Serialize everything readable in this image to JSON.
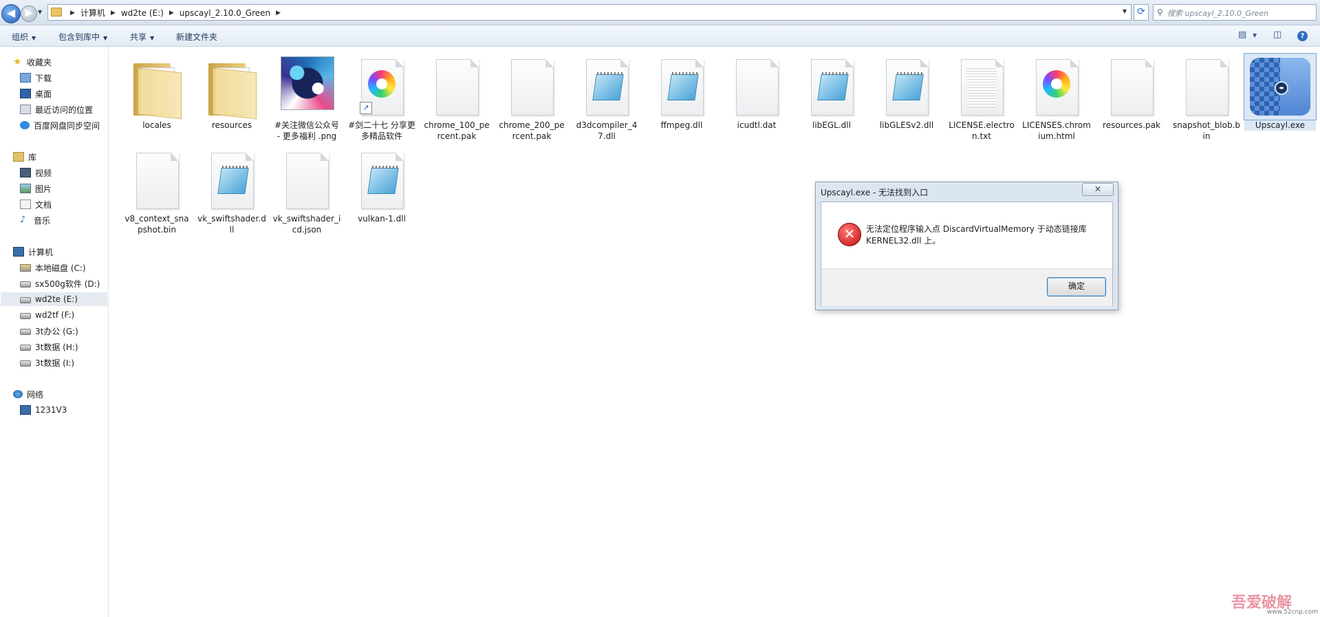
{
  "address": {
    "crumbs": [
      "计算机",
      "wd2te (E:)",
      "upscayl_2.10.0_Green"
    ],
    "search_placeholder": "搜索 upscayl_2.10.0_Green"
  },
  "toolbar": {
    "organize": "组织",
    "include_in_library": "包含到库中",
    "share": "共享",
    "new_folder": "新建文件夹"
  },
  "sidebar": {
    "favorites": {
      "label": "收藏夹",
      "items": [
        "下载",
        "桌面",
        "最近访问的位置",
        "百度网盘同步空间"
      ]
    },
    "libraries": {
      "label": "库",
      "items": [
        "视频",
        "图片",
        "文档",
        "音乐"
      ]
    },
    "computer": {
      "label": "计算机",
      "items": [
        "本地磁盘 (C:)",
        "sx500g软件 (D:)",
        "wd2te (E:)",
        "wd2tf (F:)",
        "3t办公 (G:)",
        "3t数据 (H:)",
        "3t数据 (I:)"
      ]
    },
    "network": {
      "label": "网络",
      "items": [
        "1231V3"
      ]
    }
  },
  "files": [
    {
      "name": "locales",
      "icon": "folder-icon"
    },
    {
      "name": "resources",
      "icon": "folder-icon"
    },
    {
      "name": "#关注微信公众号 - 更多福利 .png",
      "icon": "image-thumbnail-icon"
    },
    {
      "name": "#剑二十七 分享更多精品软件",
      "icon": "shortcut-icon"
    },
    {
      "name": "chrome_100_percent.pak",
      "icon": "file-icon"
    },
    {
      "name": "chrome_200_percent.pak",
      "icon": "file-icon"
    },
    {
      "name": "d3dcompiler_47.dll",
      "icon": "dll-icon"
    },
    {
      "name": "ffmpeg.dll",
      "icon": "dll-icon"
    },
    {
      "name": "icudtl.dat",
      "icon": "file-icon"
    },
    {
      "name": "libEGL.dll",
      "icon": "dll-icon"
    },
    {
      "name": "libGLESv2.dll",
      "icon": "dll-icon"
    },
    {
      "name": "LICENSE.electron.txt",
      "icon": "text-file-icon"
    },
    {
      "name": "LICENSES.chromium.html",
      "icon": "html-file-icon"
    },
    {
      "name": "resources.pak",
      "icon": "file-icon"
    },
    {
      "name": "snapshot_blob.bin",
      "icon": "file-icon"
    },
    {
      "name": "Upscayl.exe",
      "icon": "upscayl-app-icon"
    },
    {
      "name": "v8_context_snapshot.bin",
      "icon": "file-icon"
    },
    {
      "name": "vk_swiftshader.dll",
      "icon": "dll-icon"
    },
    {
      "name": "vk_swiftshader_icd.json",
      "icon": "file-icon"
    },
    {
      "name": "vulkan-1.dll",
      "icon": "dll-icon"
    }
  ],
  "dialog": {
    "title": "Upscayl.exe - 无法找到入口",
    "message": "无法定位程序输入点 DiscardVirtualMemory 于动态链接库 KERNEL32.dll 上。",
    "ok_label": "确定",
    "close_label": "✕"
  },
  "watermark": {
    "text": "吾爱破解",
    "url": "www.52cnp.com"
  }
}
